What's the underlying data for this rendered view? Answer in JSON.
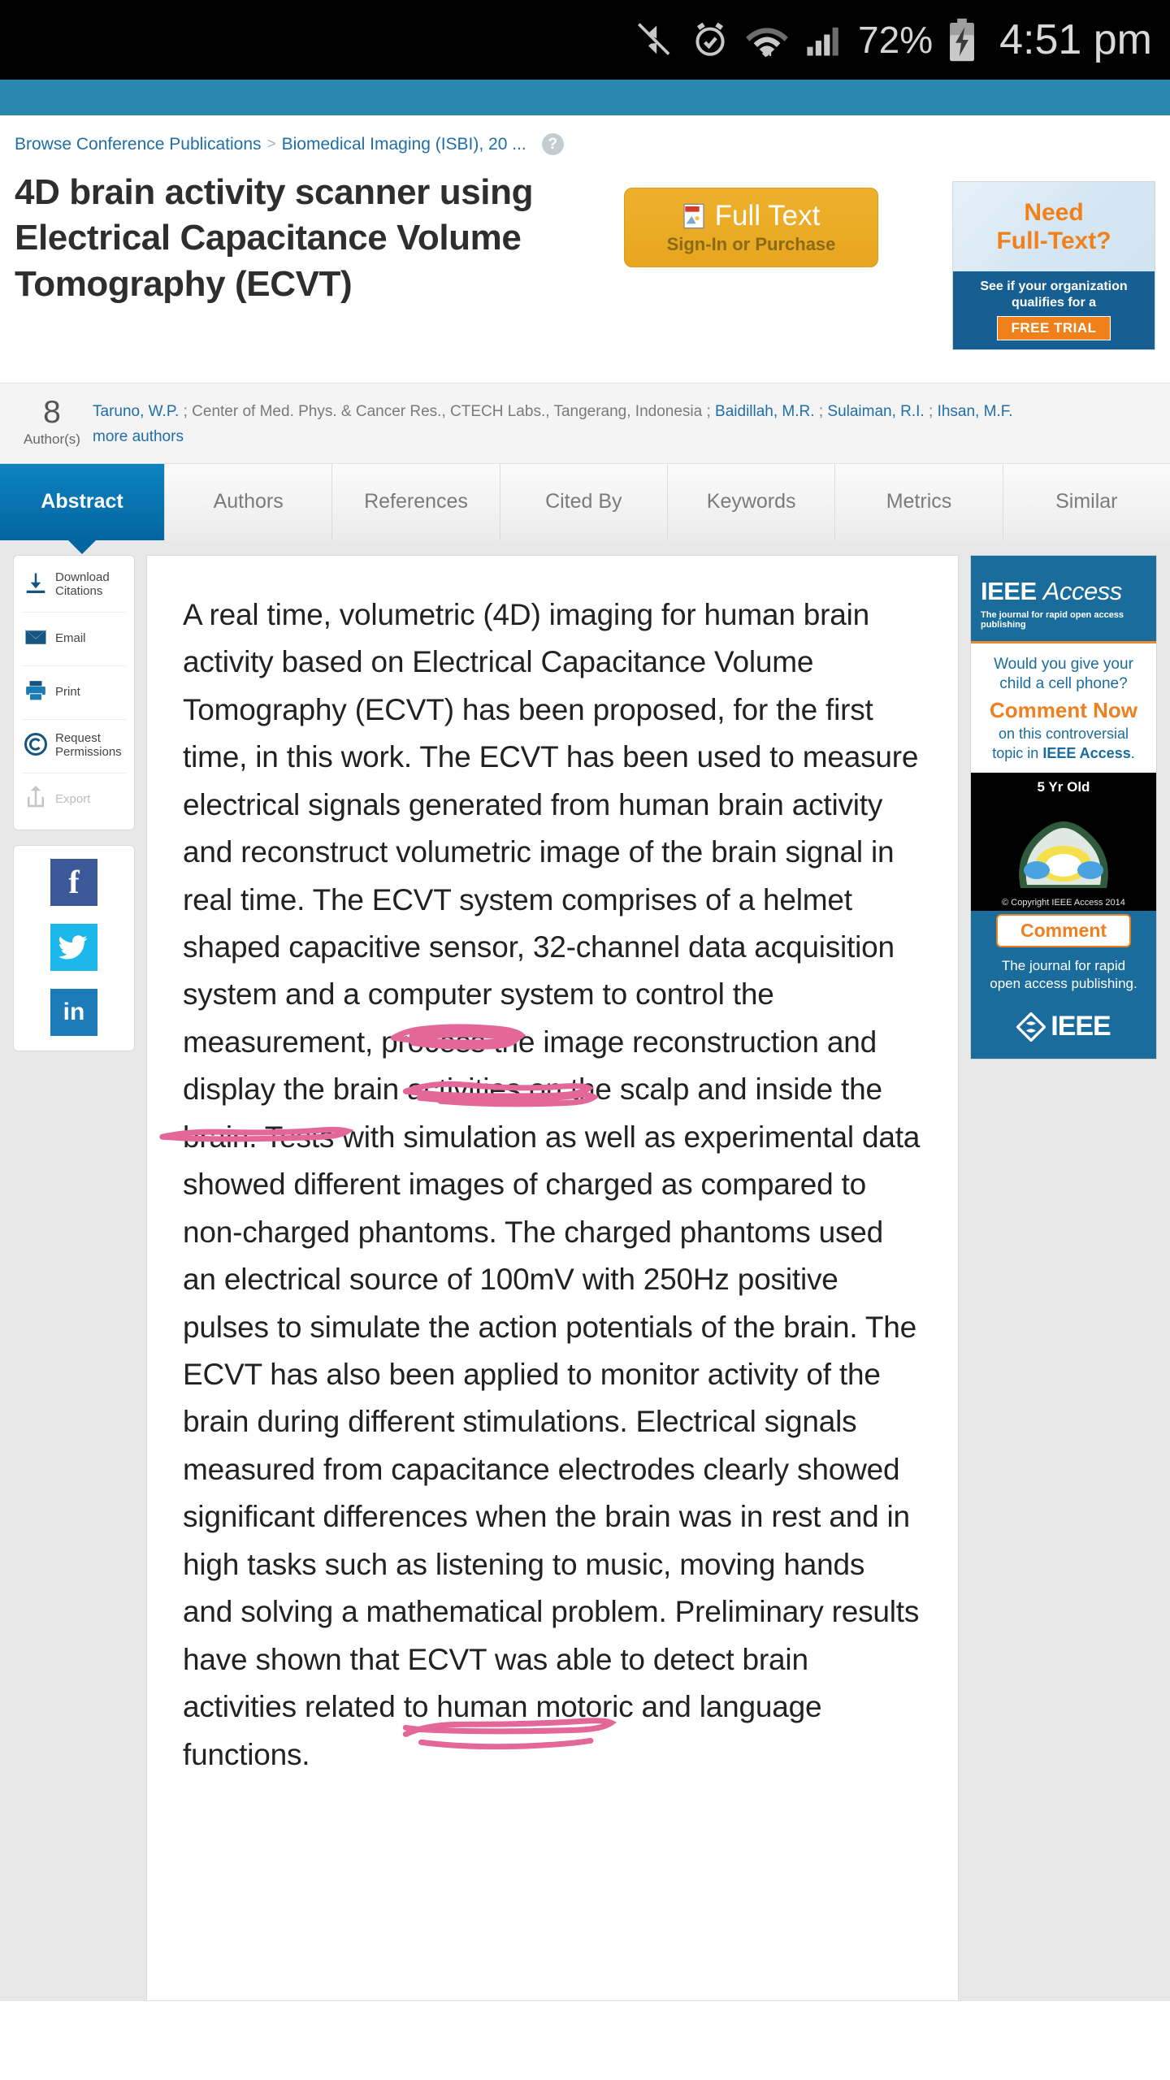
{
  "statusbar": {
    "battery_percent": "72%",
    "time": "4:51 pm",
    "icons": [
      "mute-icon",
      "alarm-icon",
      "wifi-icon",
      "signal-icon",
      "battery-charging-icon"
    ]
  },
  "breadcrumb": {
    "item1": "Browse Conference Publications",
    "separator": ">",
    "item2": "Biomedical Imaging (ISBI), 20 ...",
    "help": "?"
  },
  "document": {
    "title": "4D brain activity scanner using Electrical Capacitance Volume Tomography (ECVT)"
  },
  "fulltext": {
    "label": "Full Text",
    "sublabel": "Sign-In or Purchase"
  },
  "trial_ad": {
    "line1": "Need",
    "line2": "Full-Text?",
    "body": "See if your organization qualifies for a",
    "button": "FREE TRIAL"
  },
  "authors": {
    "count": "8",
    "count_label": "Author(s)",
    "list": [
      {
        "name": "Taruno, W.P.",
        "link": true
      },
      {
        "name": "Center of Med. Phys. & Cancer Res., CTECH Labs., Tangerang, Indonesia",
        "link": false
      },
      {
        "name": "Baidillah, M.R.",
        "link": true
      },
      {
        "name": "Sulaiman, R.I.",
        "link": true
      },
      {
        "name": "Ihsan, M.F.",
        "link": true
      }
    ],
    "more": "more authors"
  },
  "tabs": [
    {
      "label": "Abstract",
      "active": true
    },
    {
      "label": "Authors",
      "active": false
    },
    {
      "label": "References",
      "active": false
    },
    {
      "label": "Cited By",
      "active": false
    },
    {
      "label": "Keywords",
      "active": false
    },
    {
      "label": "Metrics",
      "active": false
    },
    {
      "label": "Similar",
      "active": false
    }
  ],
  "rail": {
    "tools": [
      {
        "label": "Download Citations",
        "icon": "download-icon",
        "disabled": false
      },
      {
        "label": "Email",
        "icon": "email-icon",
        "disabled": false
      },
      {
        "label": "Print",
        "icon": "print-icon",
        "disabled": false
      },
      {
        "label": "Request Permissions",
        "icon": "copyright-icon",
        "disabled": false
      },
      {
        "label": "Export",
        "icon": "export-icon",
        "disabled": true
      }
    ],
    "social": [
      {
        "name": "facebook-icon",
        "glyph": "f"
      },
      {
        "name": "twitter-icon",
        "glyph": "ᵕ"
      },
      {
        "name": "linkedin-icon",
        "glyph": "in"
      }
    ]
  },
  "abstract": {
    "text": "A real time, volumetric (4D) imaging for human brain activity based on Electrical Capacitance Volume Tomography (ECVT) has been proposed, for the first time, in this work. The ECVT has been used to measure electrical signals generated from human brain activity and reconstruct volumetric image of the brain signal in real time. The ECVT system comprises of a helmet shaped capacitive sensor, 32-channel data acquisition system and a computer system to control the measurement, process the image reconstruction and display the brain activities on the scalp and inside the brain. Tests with simulation as well as experimental data showed different images of charged as compared to non-charged phantoms. The charged phantoms used an electrical source of 100mV with 250Hz positive pulses to simulate the action potentials of the brain. The ECVT has also been applied to monitor activity of the brain during different stimulations. Electrical signals measured from capacitance electrodes clearly showed significant differences when the brain was in rest and in high tasks such as listening to music, moving hands and solving a mathematical problem. Preliminary results have shown that ECVT was able to detect brain activities related to human motoric and language functions.",
    "annotation_color": "#e4679a",
    "annotations": [
      {
        "name": "ink-underline-phantoms",
        "near": "non-charged phantoms"
      },
      {
        "name": "ink-underline-action",
        "near": "simulate the action"
      },
      {
        "name": "ink-underline-potentials-brain",
        "near": "potentials of the brain"
      },
      {
        "name": "ink-underline-brain-activities",
        "near": "brain activities related to"
      }
    ]
  },
  "ieee_ad": {
    "brand_ieee": "IEEE",
    "brand_access": "Access",
    "brand_tagline": "The journal for rapid open access publishing",
    "question": "Would you give your child a cell phone?",
    "cta": "Comment Now",
    "cta_sub_1": "on this controversial",
    "cta_sub_2": "topic in ",
    "cta_sub_2b": "IEEE Access",
    "cta_sub_2c": ".",
    "image_label": "5 Yr Old",
    "copyright": "© Copyright IEEE Access 2014",
    "comment_button": "Comment",
    "tail_1": "The journal for rapid",
    "tail_2": "open access publishing.",
    "logo": "IEEE"
  },
  "colors": {
    "tab_active": "#0466a0",
    "link": "#1f6ea8",
    "fulltext_button": "#e8a61f",
    "ieee_blue": "#1a6c9c",
    "ieee_orange": "#ef7f1f",
    "ink_pink": "#e4679a",
    "teal_bar": "#2a87ad"
  }
}
